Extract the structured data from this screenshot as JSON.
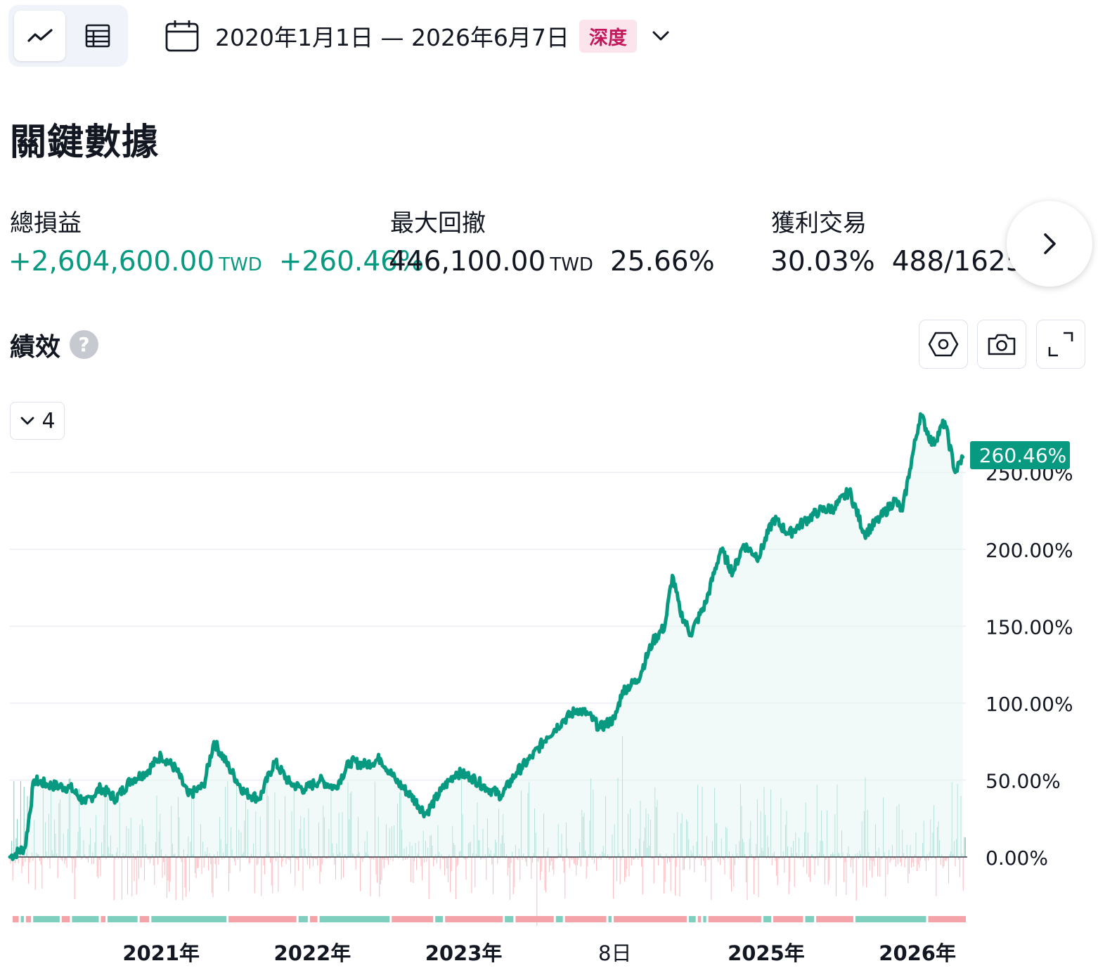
{
  "toolbar": {
    "view_chart_icon": "line-chart-icon",
    "view_table_icon": "table-icon",
    "calendar_icon": "calendar-icon",
    "date_range": "2020年1月1日 — 2026年6月7日",
    "mode_badge": "深度",
    "dropdown_icon": "chevron-down-icon"
  },
  "section_title": "關鍵數據",
  "stats": {
    "net_profit": {
      "label": "總損益",
      "amount": "+2,604,600.00",
      "unit": "TWD",
      "percent": "+260.46%"
    },
    "max_drawdown": {
      "label": "最大回撤",
      "amount": "446,100.00",
      "unit": "TWD",
      "percent": "25.66%"
    },
    "profitable_trades": {
      "label": "獲利交易",
      "percent": "30.03%",
      "ratio": "488/1625"
    },
    "next_icon": "chevron-right-icon"
  },
  "performance": {
    "title": "績效",
    "help_label": "?",
    "settings_icon": "hexagon-settings-icon",
    "screenshot_icon": "camera-icon",
    "fullscreen_icon": "fullscreen-icon",
    "collapse_label": "4"
  },
  "colors": {
    "accent": "#089981",
    "positive_bar": "#26a69a",
    "negative_bar": "#f7a1a8",
    "badge_text": "#c2185b"
  },
  "chart_data": {
    "type": "area",
    "current_value_label": "260.46%",
    "y_ticks": [
      "0.00%",
      "50.00%",
      "100.00%",
      "150.00%",
      "200.00%",
      "250.00%"
    ],
    "ylim": [
      -30,
      290
    ],
    "x_ticks": [
      "2021年",
      "2022年",
      "2023年",
      "8日",
      "2025年",
      "2026年"
    ],
    "series": [
      {
        "values": [
          [
            2020.0,
            0
          ],
          [
            2020.1,
            6
          ],
          [
            2020.16,
            50
          ],
          [
            2020.25,
            47
          ],
          [
            2020.4,
            45
          ],
          [
            2020.5,
            35
          ],
          [
            2020.6,
            45
          ],
          [
            2020.7,
            38
          ],
          [
            2020.8,
            50
          ],
          [
            2020.9,
            55
          ],
          [
            2021.0,
            66
          ],
          [
            2021.1,
            57
          ],
          [
            2021.18,
            40
          ],
          [
            2021.28,
            46
          ],
          [
            2021.35,
            75
          ],
          [
            2021.45,
            58
          ],
          [
            2021.55,
            42
          ],
          [
            2021.65,
            38
          ],
          [
            2021.75,
            62
          ],
          [
            2021.85,
            48
          ],
          [
            2021.95,
            44
          ],
          [
            2022.05,
            50
          ],
          [
            2022.15,
            45
          ],
          [
            2022.25,
            62
          ],
          [
            2022.35,
            60
          ],
          [
            2022.45,
            64
          ],
          [
            2022.55,
            50
          ],
          [
            2022.65,
            40
          ],
          [
            2022.75,
            28
          ],
          [
            2022.85,
            43
          ],
          [
            2022.95,
            55
          ],
          [
            2023.05,
            52
          ],
          [
            2023.15,
            45
          ],
          [
            2023.25,
            40
          ],
          [
            2023.35,
            55
          ],
          [
            2023.45,
            65
          ],
          [
            2023.55,
            78
          ],
          [
            2023.65,
            88
          ],
          [
            2023.75,
            96
          ],
          [
            2023.82,
            93
          ],
          [
            2023.9,
            84
          ],
          [
            2024.0,
            90
          ],
          [
            2024.05,
            108
          ],
          [
            2024.15,
            115
          ],
          [
            2024.25,
            140
          ],
          [
            2024.33,
            150
          ],
          [
            2024.38,
            183
          ],
          [
            2024.43,
            160
          ],
          [
            2024.5,
            145
          ],
          [
            2024.6,
            165
          ],
          [
            2024.7,
            200
          ],
          [
            2024.78,
            185
          ],
          [
            2024.85,
            203
          ],
          [
            2024.95,
            195
          ],
          [
            2025.05,
            220
          ],
          [
            2025.15,
            210
          ],
          [
            2025.25,
            218
          ],
          [
            2025.35,
            225
          ],
          [
            2025.45,
            227
          ],
          [
            2025.55,
            238
          ],
          [
            2025.65,
            210
          ],
          [
            2025.75,
            220
          ],
          [
            2025.85,
            232
          ],
          [
            2025.9,
            225
          ],
          [
            2025.95,
            252
          ],
          [
            2026.02,
            288
          ],
          [
            2026.1,
            268
          ],
          [
            2026.18,
            283
          ],
          [
            2026.25,
            250
          ],
          [
            2026.3,
            260
          ]
        ]
      }
    ],
    "period_bars": {
      "positive_color": "#26a69a",
      "negative_color": "#f7a1a8"
    },
    "period_strip": "alternating green/red segments under the chart",
    "grid": true
  }
}
